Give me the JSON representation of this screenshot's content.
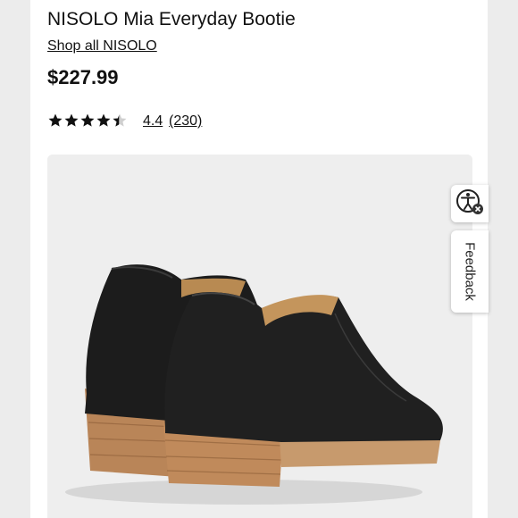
{
  "product": {
    "title": "NISOLO Mia Everyday Bootie",
    "shop_link": "Shop all NISOLO",
    "price": "$227.99"
  },
  "rating": {
    "stars": 4.4,
    "value_label": "4.4",
    "count_label": "(230)"
  },
  "image": {
    "subject": "black leather ankle bootie pair with stacked wood heel",
    "background_color": "#eeeeee"
  },
  "side_widgets": {
    "accessibility_icon": "accessibility-icon",
    "feedback_label": "Feedback"
  }
}
